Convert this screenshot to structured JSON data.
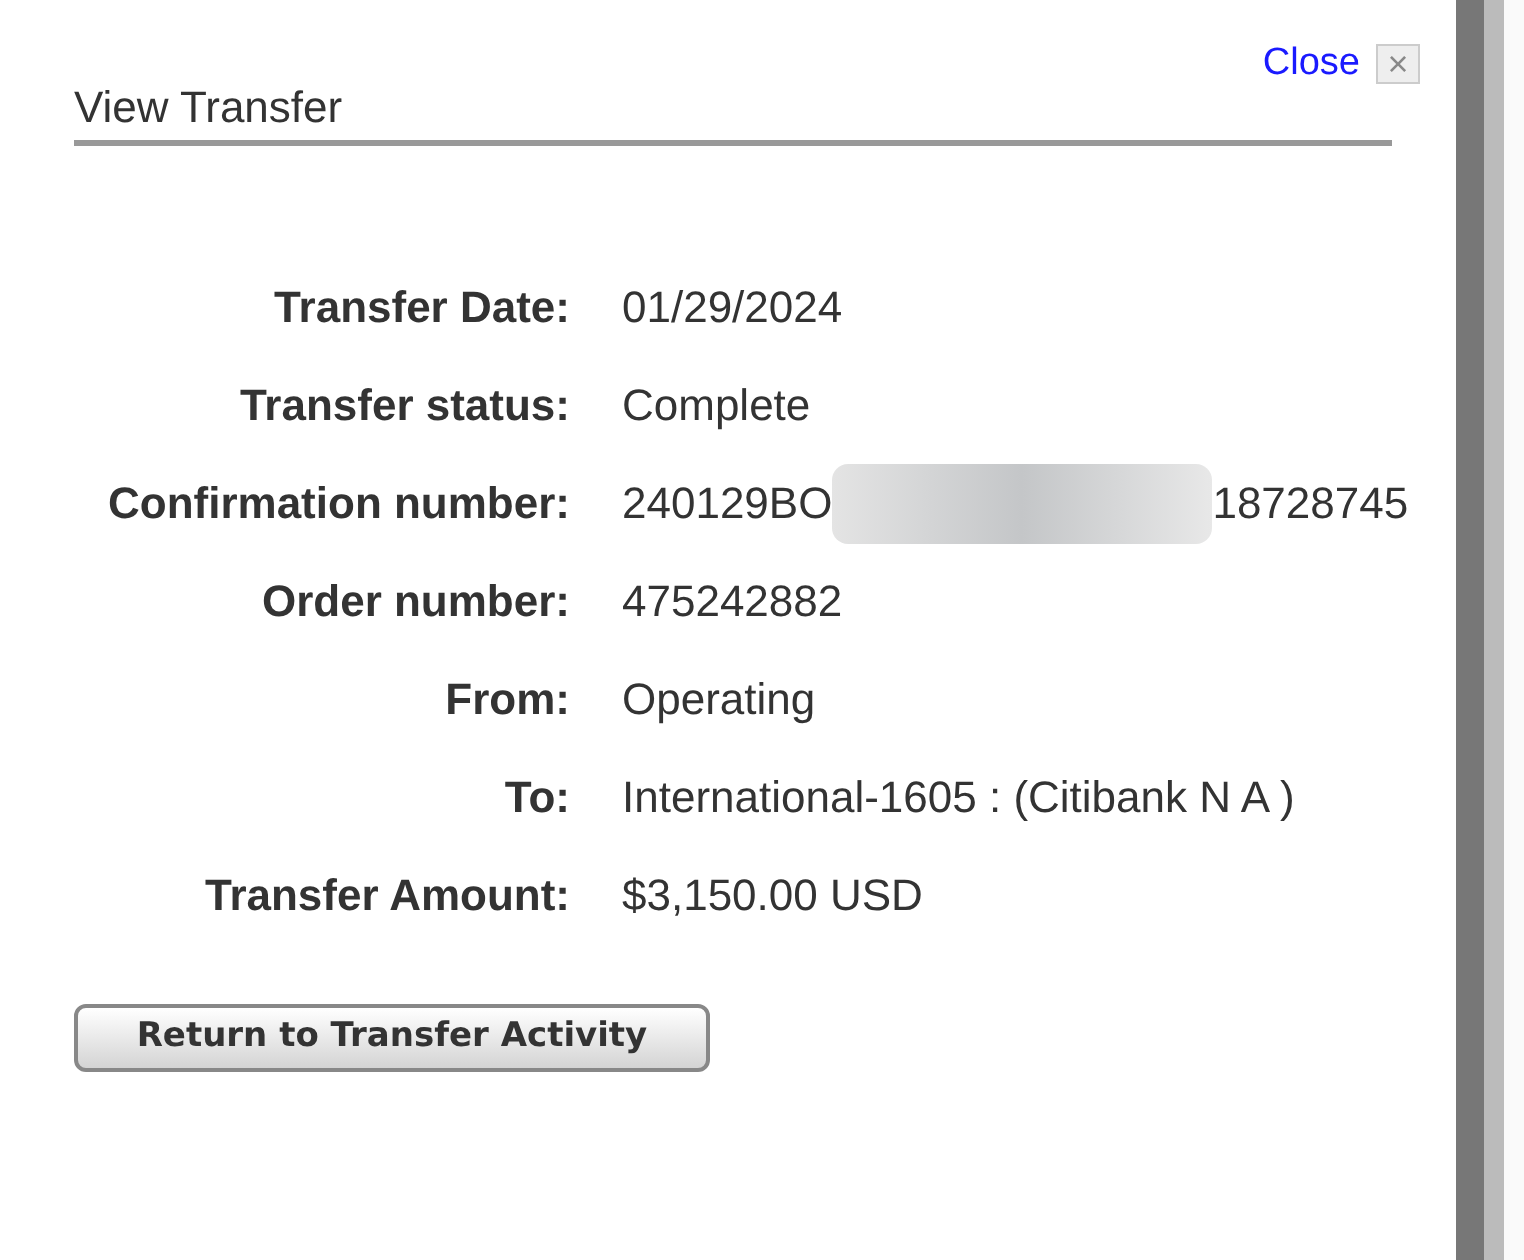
{
  "dialog": {
    "title": "View Transfer",
    "close_link": "Close",
    "close_icon": "×"
  },
  "details": [
    {
      "label": "Transfer Date:",
      "value": "01/29/2024"
    },
    {
      "label": "Transfer status:",
      "value": "Complete"
    },
    {
      "label": "Confirmation number:",
      "value": "240129BO",
      "value_end": "18728745",
      "kind": "redacted"
    },
    {
      "label": "Order number:",
      "value": "475242882"
    },
    {
      "label": "From:",
      "value": "Operating"
    },
    {
      "label": "To:",
      "value": "International-1605 : (Citibank N A )"
    },
    {
      "label": "Transfer Amount:",
      "value": "$3,150.00 USD"
    }
  ],
  "button": "Return to Transfer Activity"
}
